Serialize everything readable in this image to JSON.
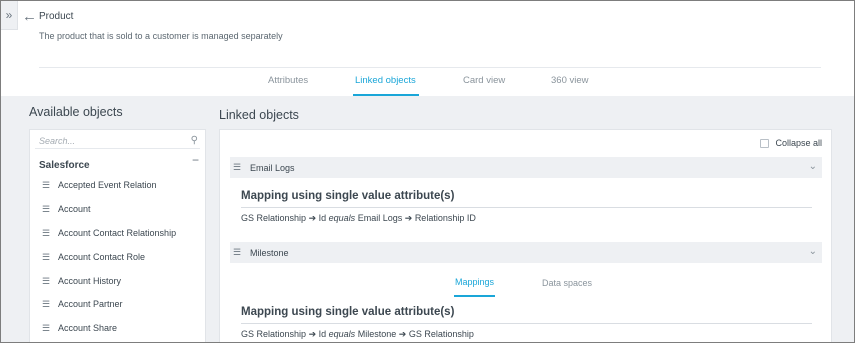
{
  "header": {
    "title": "Product",
    "subtitle": "The product that is sold to a customer is managed separately",
    "back_icon": "arrow-left-icon",
    "rail_toggle_icon": "double-chevron-right-icon"
  },
  "tabs": [
    {
      "label": "Attributes",
      "active": false
    },
    {
      "label": "Linked objects",
      "active": true
    },
    {
      "label": "Card view",
      "active": false
    },
    {
      "label": "360 view",
      "active": false
    }
  ],
  "available": {
    "title": "Available objects",
    "search_placeholder": "Search...",
    "group_label": "Salesforce",
    "group_toggle": "−",
    "items": [
      {
        "label": "Accepted Event Relation"
      },
      {
        "label": "Account"
      },
      {
        "label": "Account Contact Relationship"
      },
      {
        "label": "Account Contact Role"
      },
      {
        "label": "Account History"
      },
      {
        "label": "Account Partner"
      },
      {
        "label": "Account Share"
      }
    ]
  },
  "linked": {
    "title": "Linked objects",
    "collapse_all_label": "Collapse all",
    "collapse_all_checked": false,
    "cards": [
      {
        "name": "Email Logs",
        "mapping_title": "Mapping using single value attribute(s)",
        "mapping": {
          "left": "GS Relationship",
          "arrow1": "➔",
          "field": "Id",
          "op": "equals",
          "target": "Email Logs",
          "arrow2": "➔",
          "right": "Relationship ID"
        }
      },
      {
        "name": "Milestone",
        "sub_tabs": [
          {
            "label": "Mappings",
            "active": true
          },
          {
            "label": "Data spaces",
            "active": false
          }
        ],
        "mapping_title": "Mapping using single value attribute(s)",
        "mapping": {
          "left": "GS Relationship",
          "arrow1": "➔",
          "field": "Id",
          "op": "equals",
          "target": "Milestone",
          "arrow2": "➔",
          "right": "GS Relationship"
        }
      }
    ]
  },
  "colors": {
    "accent": "#1aa6d8",
    "background": "#eef0f3",
    "text": "#3c4750"
  }
}
